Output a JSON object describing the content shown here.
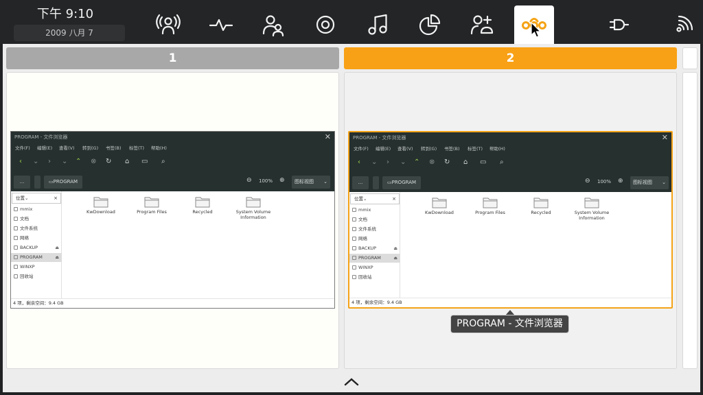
{
  "clock": {
    "time": "下午 9:10",
    "date": "2009 八月 7"
  },
  "taskbar": {
    "buttons": [
      {
        "icon": "broadcast-person-icon"
      },
      {
        "icon": "pulse-icon"
      },
      {
        "icon": "users-icon"
      },
      {
        "icon": "target-icon"
      },
      {
        "icon": "music-icon"
      },
      {
        "icon": "pie-chart-icon"
      },
      {
        "icon": "add-user-icon"
      },
      {
        "icon": "workspace-switcher-icon",
        "active": true
      },
      {
        "icon": "plug-icon"
      },
      {
        "icon": "wifi-signal-icon"
      }
    ],
    "accent": "#f5a316"
  },
  "workspaces": [
    {
      "label": "1",
      "color": "#a8a8a8"
    },
    {
      "label": "2",
      "color": "#f8a116"
    },
    {
      "label": ""
    }
  ],
  "window": {
    "title": "PROGRAM - 文件浏览器",
    "close": "✕",
    "menu": [
      "文件(F)",
      "编辑(E)",
      "查看(V)",
      "转到(G)",
      "书签(B)",
      "标签(T)",
      "帮助(H)"
    ],
    "path_more": "...",
    "path_location": "PROGRAM",
    "zoom": "100%",
    "view_mode": "图标视图",
    "sidebar_header": "位置",
    "sidebar_close": "×",
    "sidebar_items": [
      "mmix",
      "文档",
      "文件系统",
      "网络",
      "BACKUP",
      "PROGRAM",
      "WINXP",
      "回收站"
    ],
    "files": [
      "KwDownload",
      "Program Files",
      "Recycled",
      "System Volume Information"
    ],
    "status": "4 项，剩余空间：9.4 GB"
  },
  "tooltip": {
    "text": "PROGRAM - 文件浏览器"
  }
}
